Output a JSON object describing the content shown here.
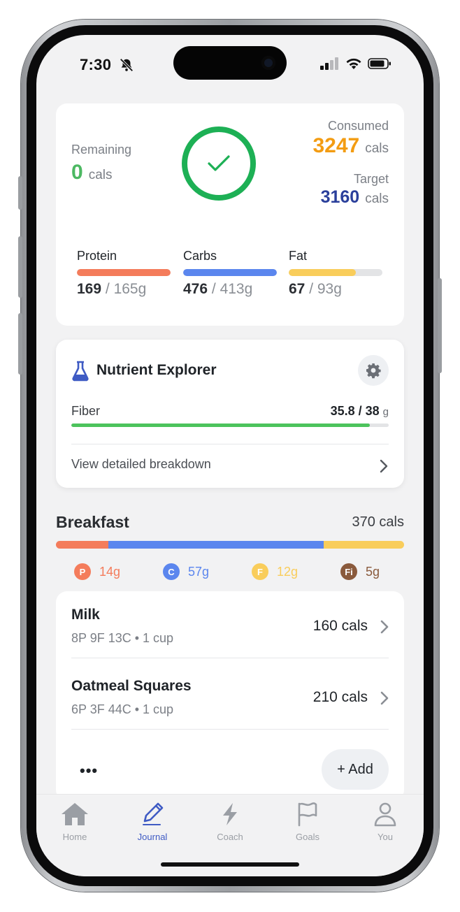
{
  "status_bar": {
    "time": "7:30"
  },
  "summary": {
    "remaining_label": "Remaining",
    "remaining_value": "0",
    "remaining_unit": "cals",
    "consumed_label": "Consumed",
    "consumed_value": "3247",
    "consumed_unit": "cals",
    "target_label": "Target",
    "target_value": "3160",
    "target_unit": "cals",
    "macros": [
      {
        "label": "Protein",
        "consumed": "169",
        "goal": "165g",
        "progress": 1.0,
        "color": "#f47c5b"
      },
      {
        "label": "Carbs",
        "consumed": "476",
        "goal": "413g",
        "progress": 1.0,
        "color": "#5b86ee"
      },
      {
        "label": "Fat",
        "consumed": "67",
        "goal": "93g",
        "progress": 0.72,
        "color": "#f9cd5b"
      }
    ]
  },
  "nutrient_explorer": {
    "title": "Nutrient Explorer",
    "fiber_label": "Fiber",
    "fiber_value": "35.8 / 38",
    "fiber_unit": "g",
    "fiber_progress": 0.94,
    "breakdown_link": "View detailed breakdown"
  },
  "breakfast": {
    "title": "Breakfast",
    "cals": "370 cals",
    "bar_segments": [
      {
        "macro": "protein",
        "fraction": 0.15,
        "color": "#f47c5b"
      },
      {
        "macro": "carbs",
        "fraction": 0.62,
        "color": "#5b86ee"
      },
      {
        "macro": "fat",
        "fraction": 0.23,
        "color": "#f9cd5b"
      }
    ],
    "macro_chips": [
      {
        "letter": "P",
        "value": "14g",
        "color": "#f47c5b"
      },
      {
        "letter": "C",
        "value": "57g",
        "color": "#5b86ee"
      },
      {
        "letter": "F",
        "value": "12g",
        "color": "#f9cd5b"
      },
      {
        "letter": "Fi",
        "value": "5g",
        "color": "#8a5a3c"
      }
    ],
    "items": [
      {
        "name": "Milk",
        "detail": "8P  9F  13C • 1 cup",
        "cals": "160 cals"
      },
      {
        "name": "Oatmeal Squares",
        "detail": "6P  3F  44C • 1 cup",
        "cals": "210 cals"
      }
    ],
    "more_label": "•••",
    "add_label": "+ Add"
  },
  "tabbar": {
    "tabs": [
      {
        "label": "Home",
        "icon": "home-icon"
      },
      {
        "label": "Journal",
        "icon": "pencil-icon",
        "active": true
      },
      {
        "label": "Coach",
        "icon": "lightning-icon"
      },
      {
        "label": "Goals",
        "icon": "flag-icon"
      },
      {
        "label": "You",
        "icon": "person-icon"
      }
    ],
    "active_color": "#3f5bc4"
  }
}
